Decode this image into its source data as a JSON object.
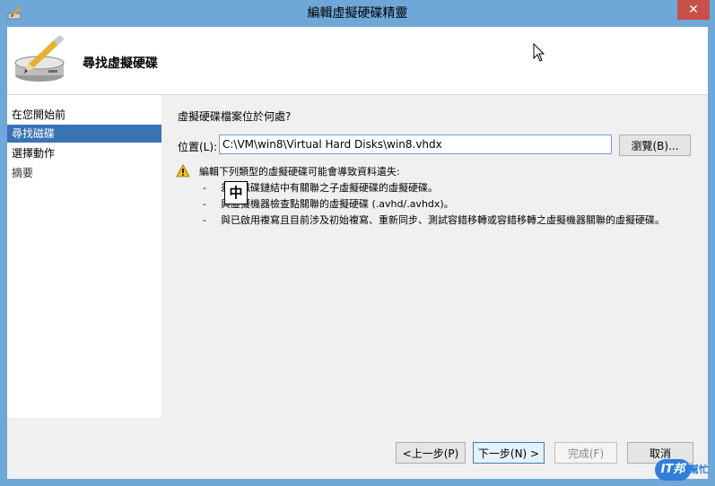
{
  "window": {
    "title": "編輯虛擬硬碟精靈",
    "close_glyph": "✕"
  },
  "header": {
    "title": "尋找虛擬硬碟",
    "icon": "disk-pencil-icon"
  },
  "steps": [
    {
      "label": "在您開始前",
      "state": "normal"
    },
    {
      "label": "尋找磁碟",
      "state": "active"
    },
    {
      "label": "選擇動作",
      "state": "normal"
    },
    {
      "label": "摘要",
      "state": "disabled"
    }
  ],
  "content": {
    "question": "虛擬硬碟檔案位於何處?",
    "location_label": "位置(L):",
    "location_value": "C:\\VM\\win8\\Virtual Hard Disks\\win8.vhdx",
    "browse_label": "瀏覽(B)...",
    "warning_text": "編輯下列類型的虛擬硬碟可能會導致資料遺失:",
    "warning_items": [
      "差異磁碟鏈結中有關聯之子虛擬硬碟的虛擬硬碟。",
      "與虛擬機器檢查點關聯的虛擬硬碟 (.avhd/.avhdx)。",
      "與已啟用複寫且目前涉及初始複寫、重新同步、測試容錯移轉或容錯移轉之虛擬機器關聯的虛擬硬碟。"
    ],
    "ime_char": "中"
  },
  "footer": {
    "prev_label": "<上一步(P)",
    "next_label": "下一步(N) >",
    "finish_label": "完成(F)",
    "cancel_label": "取消"
  },
  "watermark": {
    "badge": "IT邦",
    "text": "幫忙"
  },
  "colors": {
    "titlebar": "#6fa8d8",
    "active_step": "#3a73b3",
    "close": "#c7504a"
  }
}
